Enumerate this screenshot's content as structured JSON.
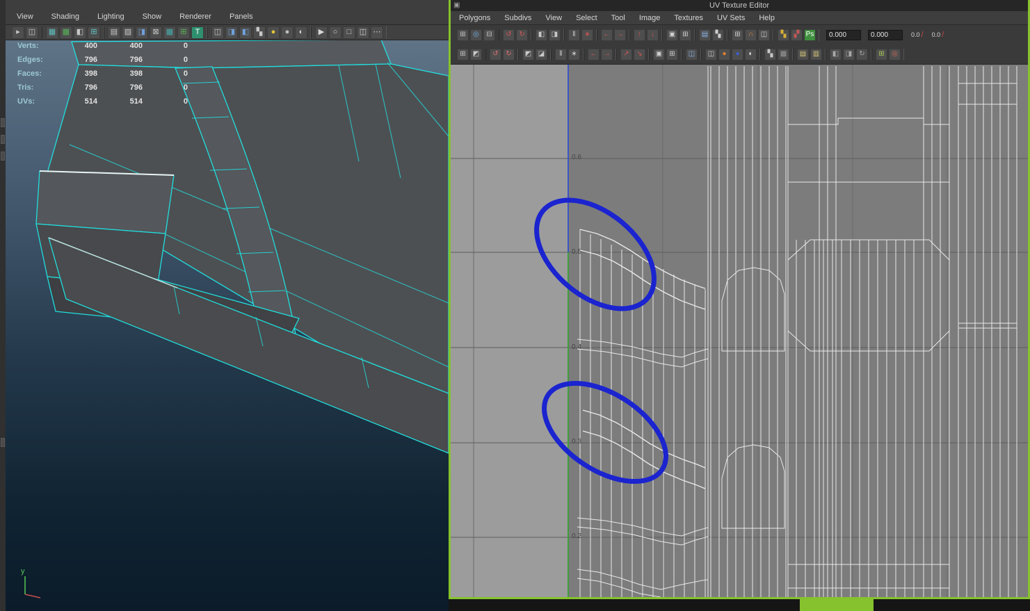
{
  "colors": {
    "accent_green": "#86c22d",
    "annotation_blue": "#1b24cf",
    "wireframe_cyan": "#21dede",
    "uv_wire_white": "#f5f5f5"
  },
  "viewport": {
    "menus": [
      "View",
      "Shading",
      "Lighting",
      "Show",
      "Renderer",
      "Panels"
    ],
    "toolbar": [
      [
        {
          "n": "history-toggle-icon",
          "g": "▸",
          "c": "#c8c8c8"
        },
        {
          "n": "selection-mode-icon",
          "g": "◫",
          "c": "#c8c8c8"
        }
      ],
      [
        {
          "n": "select-by-hierarchy-icon",
          "g": "▦",
          "c": "#5fc0c0"
        },
        {
          "n": "select-by-object-icon",
          "g": "▩",
          "c": "#58b058"
        },
        {
          "n": "select-by-component-icon",
          "g": "◧",
          "c": "#c8c8c8"
        },
        {
          "n": "snap-to-grid-icon",
          "g": "⊞",
          "c": "#5fc0c0"
        }
      ],
      [
        {
          "n": "snap-to-curve-icon",
          "g": "▤",
          "c": "#c8c8c8"
        },
        {
          "n": "snap-to-point-icon",
          "g": "▨",
          "c": "#c8c8c8"
        },
        {
          "n": "snap-to-plane-icon",
          "g": "◨",
          "c": "#6f9fd8"
        },
        {
          "n": "make-live-icon",
          "g": "⊠",
          "c": "#c8c8c8"
        },
        {
          "n": "history-on-icon",
          "g": "▩",
          "c": "#48a8a8"
        },
        {
          "n": "render-view-icon",
          "g": "⊞",
          "c": "#58b058"
        },
        {
          "n": "texture-editor-icon",
          "g": "T",
          "c": "#ffffff",
          "b": "#2f9070"
        }
      ],
      [
        {
          "n": "render-current-icon",
          "g": "◫",
          "c": "#c8c8c8"
        },
        {
          "n": "ipr-render-icon",
          "g": "◨",
          "c": "#6f9fd8"
        },
        {
          "n": "render-settings-icon",
          "g": "◧",
          "c": "#6f9fd8"
        },
        {
          "n": "paint-effects-icon",
          "g": "▚",
          "c": "#c8c8c8"
        },
        {
          "n": "yellow-material-sphere-icon",
          "g": "●",
          "c": "#e2c43c"
        },
        {
          "n": "gray-material-sphere-icon",
          "g": "●",
          "c": "#c0c0c0"
        },
        {
          "n": "shaded-sphere-icon",
          "g": "◐",
          "c": "#d0d0d0"
        }
      ],
      [
        {
          "n": "select-tool-icon",
          "g": "▶",
          "c": "#d8d8d8"
        },
        {
          "n": "lasso-tool-icon",
          "g": "○",
          "c": "#d8d8d8"
        },
        {
          "n": "translate-manip-icon",
          "g": "□",
          "c": "#d8d8d8"
        },
        {
          "n": "node-editor-icon",
          "g": "◫",
          "c": "#d8d8d8"
        },
        {
          "n": "connections-icon",
          "g": "⋯",
          "c": "#d8d8d8"
        }
      ]
    ],
    "hud": {
      "rows": [
        {
          "label": "Verts:",
          "total": "400",
          "selected": "400",
          "other": "0"
        },
        {
          "label": "Edges:",
          "total": "796",
          "selected": "796",
          "other": "0"
        },
        {
          "label": "Faces:",
          "total": "398",
          "selected": "398",
          "other": "0"
        },
        {
          "label": "Tris:",
          "total": "796",
          "selected": "796",
          "other": "0"
        },
        {
          "label": "UVs:",
          "total": "514",
          "selected": "514",
          "other": "0"
        }
      ]
    },
    "axis_label": "y"
  },
  "uv_editor": {
    "title": "UV Texture Editor",
    "window_icon": "▣",
    "menus": [
      "Polygons",
      "Subdivs",
      "View",
      "Select",
      "Tool",
      "Image",
      "Textures",
      "UV Sets",
      "Help"
    ],
    "toolbar": {
      "row1": [
        [
          {
            "n": "uv-lattice-tool-icon",
            "g": "⊞",
            "c": "#c8c8c8"
          },
          {
            "n": "move-uv-shell-tool-icon",
            "g": "◎",
            "c": "#6fa8dc"
          },
          {
            "n": "tweak-uv-tool-icon",
            "g": "⊟",
            "c": "#c8c8c8"
          }
        ],
        [
          {
            "n": "rotate-uvs-ccw-icon",
            "g": "↺",
            "c": "#d85656"
          },
          {
            "n": "rotate-uvs-cw-icon",
            "g": "↻",
            "c": "#d85656"
          }
        ],
        [
          {
            "n": "flip-u-icon",
            "g": "◧",
            "c": "#c8c8c8"
          },
          {
            "n": "flip-v-icon",
            "g": "◨",
            "c": "#c8c8c8"
          }
        ],
        [
          {
            "n": "cut-uv-edges-icon",
            "g": "‖",
            "c": "#d0d0d0"
          },
          {
            "n": "sew-uv-edges-icon",
            "g": "∗",
            "c": "#d85656"
          }
        ],
        [
          {
            "n": "align-u-min-icon",
            "g": "←",
            "c": "#d85656"
          },
          {
            "n": "align-u-max-icon",
            "g": "→",
            "c": "#d85656"
          }
        ],
        [
          {
            "n": "align-v-max-icon",
            "g": "↑",
            "c": "#d85656"
          },
          {
            "n": "align-v-min-icon",
            "g": "↓",
            "c": "#d85656"
          }
        ],
        [
          {
            "n": "layout-uvs-icon",
            "g": "▣",
            "c": "#d0d0d0"
          },
          {
            "n": "grid-uvs-icon",
            "g": "⊞",
            "c": "#d0d0d0"
          }
        ],
        [
          {
            "n": "display-image-icon",
            "g": "▤",
            "c": "#8ab4e8"
          },
          {
            "n": "dither-image-icon",
            "g": "▚",
            "c": "#d0d0d0"
          }
        ],
        [
          {
            "n": "pixel-snap-icon",
            "g": "⊞",
            "c": "#d0d0d0"
          },
          {
            "n": "magnet-snap-icon",
            "g": "∩",
            "c": "#e08838"
          },
          {
            "n": "shell-border-icon",
            "g": "◫",
            "c": "#d0d0d0"
          }
        ],
        [
          {
            "n": "checker-display-icon",
            "g": "▚",
            "c": "#d8b038"
          },
          {
            "n": "alpha-display-icon",
            "g": "▞",
            "c": "#c05858"
          },
          {
            "n": "psd-network-icon",
            "g": "Ps",
            "c": "#ffffff",
            "b": "#3f8f3f"
          }
        ]
      ],
      "row2": [
        [
          {
            "n": "uv-smudge-tool-icon",
            "g": "⊞",
            "c": "#c8c8c8"
          },
          {
            "n": "uv-select-shell-icon",
            "g": "◩",
            "c": "#c8c8c8"
          }
        ],
        [
          {
            "n": "rotate-shell-ccw-icon",
            "g": "↺",
            "c": "#e07070"
          },
          {
            "n": "rotate-shell-cw-icon",
            "g": "↻",
            "c": "#e07070"
          }
        ],
        [
          {
            "n": "flip-shell-u-icon",
            "g": "◩",
            "c": "#c8c8c8"
          },
          {
            "n": "flip-shell-v-icon",
            "g": "◪",
            "c": "#c8c8c8"
          }
        ],
        [
          {
            "n": "unfold-uvs-icon",
            "g": "‖",
            "c": "#d0d0d0"
          },
          {
            "n": "relax-uvs-icon",
            "g": "∗",
            "c": "#d0d0d0"
          }
        ],
        [
          {
            "n": "move-shell-left-icon",
            "g": "←",
            "c": "#d85656"
          },
          {
            "n": "move-shell-right-icon",
            "g": "→",
            "c": "#d85656"
          }
        ],
        [
          {
            "n": "snap-together-icon",
            "g": "↗",
            "c": "#d85656"
          },
          {
            "n": "snap-stack-icon",
            "g": "↘",
            "c": "#d85656"
          }
        ],
        [
          {
            "n": "layout-region-icon",
            "g": "▣",
            "c": "#d0d0d0"
          },
          {
            "n": "tile-layout-icon",
            "g": "⊞",
            "c": "#d0d0d0"
          }
        ],
        [
          {
            "n": "image-range-icon",
            "g": "◫",
            "c": "#8ab4e8"
          }
        ],
        [
          {
            "n": "shell-stack-icon",
            "g": "◫",
            "c": "#d0d0d0"
          },
          {
            "n": "red-channel-icon",
            "g": "●",
            "c": "#e08030"
          },
          {
            "n": "blue-channel-icon",
            "g": "●",
            "c": "#3a5fd0"
          },
          {
            "n": "alpha-channel-icon",
            "g": "◐",
            "c": "#e8e8e8"
          }
        ],
        [
          {
            "n": "checker-map-icon",
            "g": "▚",
            "c": "#c8c8c8"
          },
          {
            "n": "texture-borders-icon",
            "g": "▩",
            "c": "#9a9a9a"
          }
        ],
        [
          {
            "n": "copy-uvs-icon",
            "g": "▤",
            "c": "#d8c878"
          },
          {
            "n": "paste-uvs-icon",
            "g": "▥",
            "c": "#d8c878"
          }
        ],
        [
          {
            "n": "paste-u-icon",
            "g": "◧",
            "c": "#a8a8a8"
          },
          {
            "n": "paste-v-icon",
            "g": "◨",
            "c": "#a8a8a8"
          },
          {
            "n": "cycle-uvs-icon",
            "g": "↻",
            "c": "#a8a8a8"
          }
        ],
        [
          {
            "n": "grid-toggle-icon",
            "g": "⊞",
            "c": "#a8c858"
          },
          {
            "n": "uv-snapshot-icon",
            "g": "◎",
            "c": "#d06858"
          }
        ]
      ],
      "fields": [
        {
          "name": "u-coordinate-field",
          "value": "0.000"
        },
        {
          "name": "v-coordinate-field",
          "value": "0.000"
        }
      ],
      "angle_buttons": [
        {
          "name": "rotate-angle-ccw-button",
          "label": "0.0",
          "glyph": "/"
        },
        {
          "name": "rotate-angle-cw-button",
          "label": "0.0",
          "glyph": "/"
        }
      ]
    },
    "canvas": {
      "ticks": [
        "0.6",
        "0.5",
        "0.4",
        "0.3",
        "0.2"
      ],
      "axis_top_color": "#3e55c4",
      "axis_color": "#3f9e3c",
      "annotation_color": "#1b24cf"
    }
  }
}
